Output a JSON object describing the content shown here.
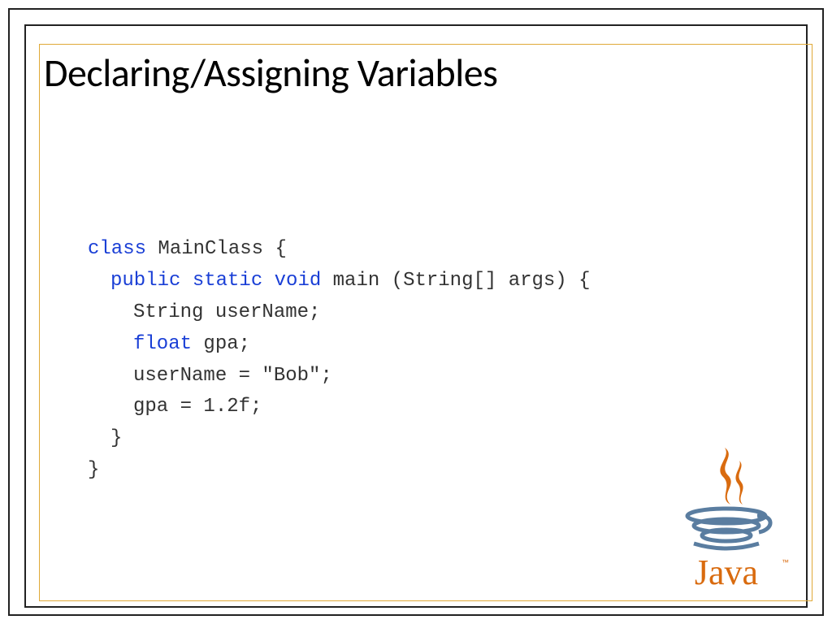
{
  "title": "Declaring/Assigning Variables",
  "code": {
    "line1_kw": "class",
    "line1_rest": " MainClass {",
    "line2_kw": "public static void",
    "line2_rest": " main (String[] args) {",
    "line3": "String userName;",
    "line4_kw": "float",
    "line4_rest": " gpa;",
    "line5": "userName = \"Bob\";",
    "line6": "gpa = 1.2f;",
    "line7": "}",
    "line8": "}"
  },
  "logo": {
    "name": "Java",
    "tm": "™"
  }
}
